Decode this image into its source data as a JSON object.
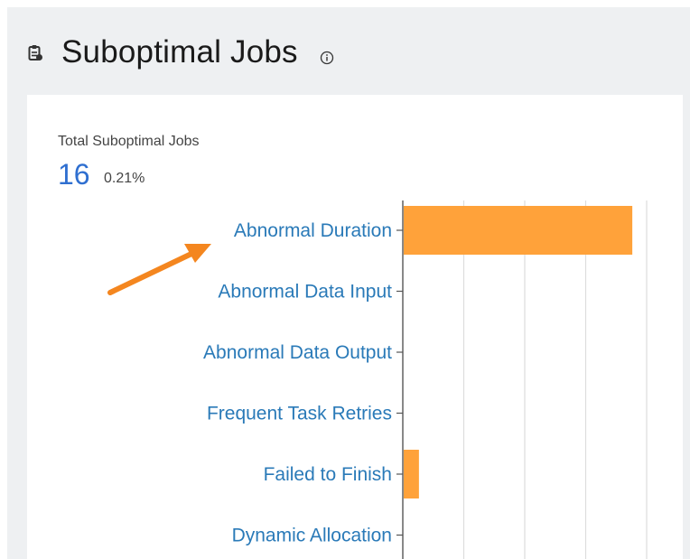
{
  "header": {
    "icon": "clipboard-icon",
    "title": "Suboptimal Jobs",
    "info_icon": "info-circle-icon"
  },
  "summary": {
    "label": "Total Suboptimal Jobs",
    "value": "16",
    "percent": "0.21%"
  },
  "colors": {
    "background": "#eef0f2",
    "card": "#ffffff",
    "bar": "#ffa23a",
    "category_text": "#2a7ab8",
    "total_value": "#2f6fd0",
    "arrow": "#f4861f",
    "grid": "#dddddd"
  },
  "annotation": {
    "type": "arrow",
    "points_to": "Abnormal Duration"
  },
  "chart_data": {
    "type": "bar",
    "orientation": "horizontal",
    "categories": [
      "Abnormal Duration",
      "Abnormal Data Input",
      "Abnormal Data Output",
      "Frequent Task Retries",
      "Failed to Finish",
      "Dynamic Allocation"
    ],
    "values": [
      15,
      0,
      0,
      0,
      1,
      0
    ],
    "xlim": [
      0,
      16
    ],
    "grid": true
  }
}
